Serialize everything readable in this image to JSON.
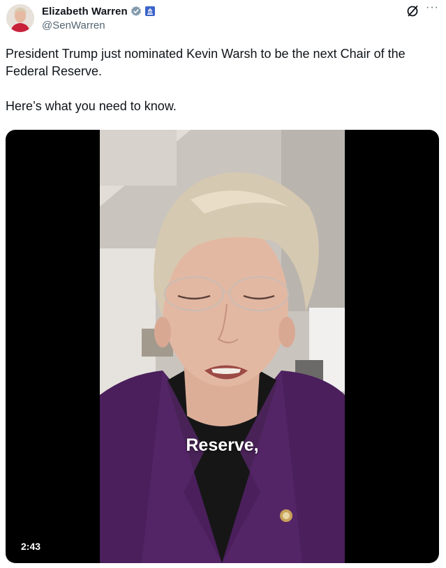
{
  "author": {
    "name": "Elizabeth Warren",
    "handle": "@SenWarren",
    "verified_icon": "verified-badge-icon",
    "affiliation_icon": "us-government-capitol-icon"
  },
  "header_actions": {
    "grok_icon": "grok-icon",
    "more_icon": "more-options-icon",
    "more_label": "···"
  },
  "tweet": {
    "text": "President Trump just nominated Kevin Warsh to be the next Chair of the Federal Reserve.\n\nHere’s what you need to know."
  },
  "video": {
    "caption": "Reserve,",
    "duration": "2:43"
  },
  "colors": {
    "text": "#0f1419",
    "secondary": "#536471",
    "verified": "#829aab",
    "media_bg": "#000000",
    "jacket": "#4a1f5c"
  }
}
